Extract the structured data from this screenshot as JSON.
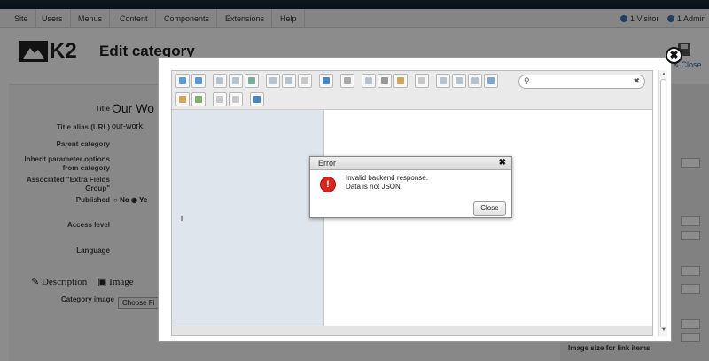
{
  "menubar": {
    "items": [
      "Site",
      "Users",
      "Menus",
      "Content",
      "Components",
      "Extensions",
      "Help"
    ],
    "visitors": "1 Visitor",
    "admins": "1 Admin"
  },
  "header": {
    "logo_text": "K2",
    "page_title": "Edit category",
    "save_close_label": "& Close"
  },
  "form": {
    "title_label": "Title",
    "title_value": "Our Wo",
    "alias_label": "Title alias (URL)",
    "alias_value": "our-work",
    "parent_label": "Parent category",
    "inherit_label": "Inherit parameter options from category",
    "extra_fields_label": "Associated \"Extra Fields Group\"",
    "published_label": "Published",
    "published_no": "No",
    "published_yes": "Ye",
    "access_label": "Access level",
    "language_label": "Language",
    "tab_description": "Description",
    "tab_image": "Image",
    "category_image_label": "Category image",
    "choose_file_label": "Choose Fi",
    "image_size_label": "Image size for link items"
  },
  "modal": {
    "close_glyph": "✖"
  },
  "filemanager": {
    "search_placeholder": "",
    "search_icon": "⚲",
    "clear_icon": "✖"
  },
  "error_dialog": {
    "title": "Error",
    "close_glyph": "✖",
    "icon_glyph": "!",
    "message_line1": "Invalid backend response.",
    "message_line2": "Data is not JSON.",
    "close_button": "Close"
  },
  "colors": {
    "error_red": "#d9261c",
    "topbar": "#1a2b3c",
    "tree_bg": "#dfe5ec"
  }
}
